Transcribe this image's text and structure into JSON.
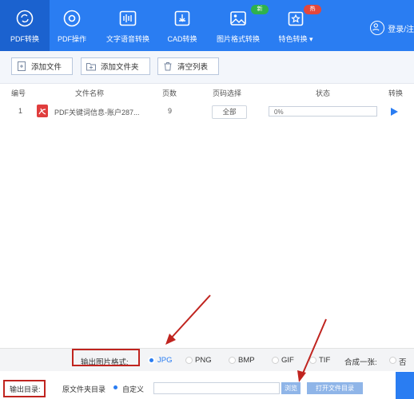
{
  "nav": {
    "tabs": [
      {
        "label": "PDF转换",
        "icon": "refresh-icon",
        "active": true
      },
      {
        "label": "PDF操作",
        "icon": "gear-icon"
      },
      {
        "label": "文字语音转换",
        "icon": "waveform-icon"
      },
      {
        "label": "CAD转换",
        "icon": "cad-icon"
      },
      {
        "label": "图片格式转换",
        "icon": "image-icon",
        "badge": "新",
        "badge_color": "#2fb24c"
      },
      {
        "label": "特色转换 ▾",
        "icon": "star-icon",
        "badge": "热",
        "badge_color": "#e4473c"
      }
    ],
    "login_label": "登录/注"
  },
  "toolbar": {
    "add_file": "添加文件",
    "add_folder": "添加文件夹",
    "clear_list": "清空列表"
  },
  "table": {
    "headers": [
      "编号",
      "文件名称",
      "页数",
      "页码选择",
      "状态",
      "转换"
    ],
    "rows": [
      {
        "index": "1",
        "name": "PDF关键词信息-账户287...",
        "pages": "9",
        "page_select": "全部",
        "status": "0%",
        "progress": 0
      }
    ]
  },
  "format_bar": {
    "label": "输出图片格式:",
    "options": [
      "JPG",
      "PNG",
      "BMP",
      "GIF",
      "TIF"
    ],
    "selected": "JPG",
    "merge_label": "合成一张:",
    "merge_option": "否"
  },
  "output_bar": {
    "label": "输出目录:",
    "option_source": "原文件夹目录",
    "option_custom": "自定义",
    "path_value": "",
    "browse": "浏览",
    "open_folder": "打开文件目录"
  },
  "colors": {
    "accent": "#2a7df2",
    "annotation": "#c0241f"
  }
}
